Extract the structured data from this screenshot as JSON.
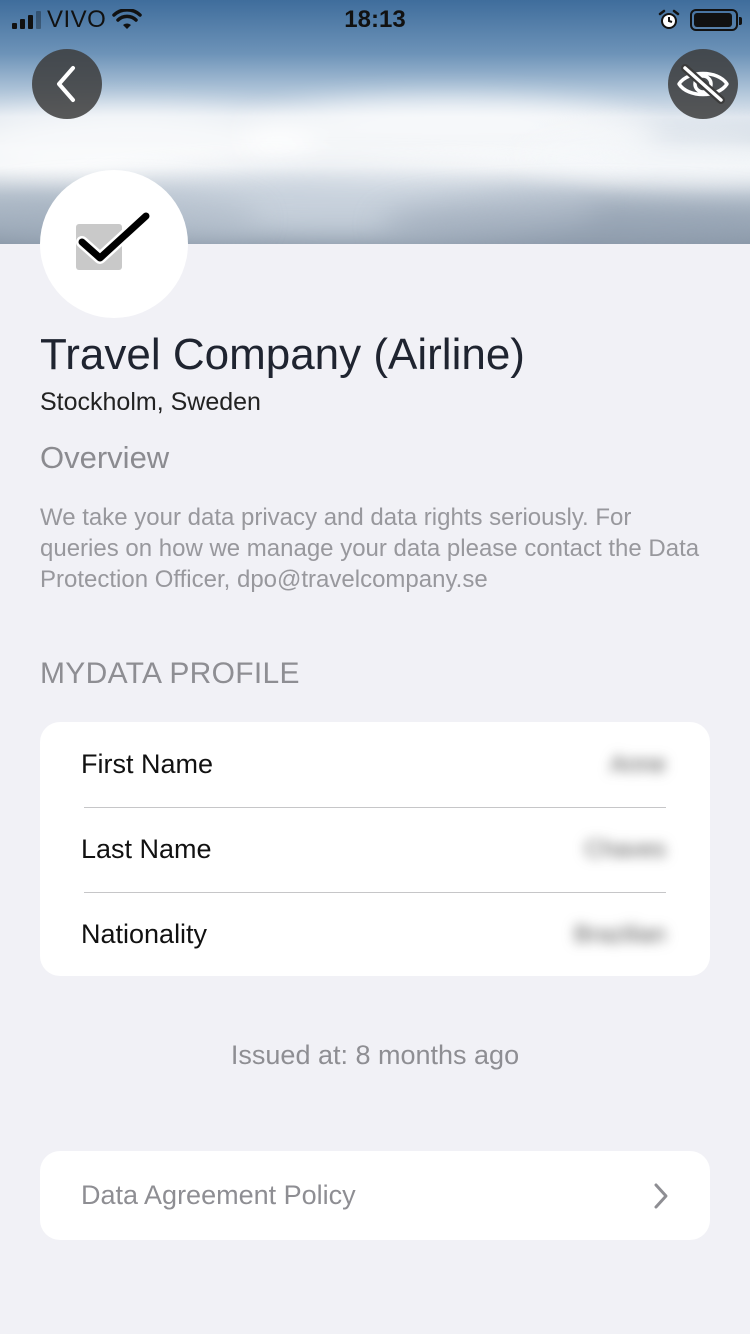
{
  "status_bar": {
    "carrier": "VIVO",
    "time": "18:13",
    "icons": [
      "signal-icon",
      "wifi-icon",
      "alarm-icon",
      "battery-icon"
    ],
    "battery_level": 0.95
  },
  "header": {
    "back_icon": "chevron-left-icon",
    "visibility_icon": "eye-off-icon"
  },
  "organization": {
    "logo_icon": "checkbox-checked-icon",
    "name": "Travel Company (Airline)",
    "location": "Stockholm, Sweden"
  },
  "overview": {
    "title": "Overview",
    "text": "We take your data privacy and data rights seriously. For queries on how we manage your data please contact the Data Protection Officer, dpo@travelcompany.se"
  },
  "profile": {
    "title": "MYDATA PROFILE",
    "rows": [
      {
        "label": "First Name",
        "value": "Anne"
      },
      {
        "label": "Last Name",
        "value": "Chaves"
      },
      {
        "label": "Nationality",
        "value": "Brazilian"
      }
    ]
  },
  "issued": "Issued at: 8 months ago",
  "policy": {
    "label": "Data Agreement Policy",
    "icon": "chevron-right-icon"
  },
  "colors": {
    "background": "#f1f1f6",
    "card": "#ffffff",
    "secondary_text": "#8e8e93"
  }
}
